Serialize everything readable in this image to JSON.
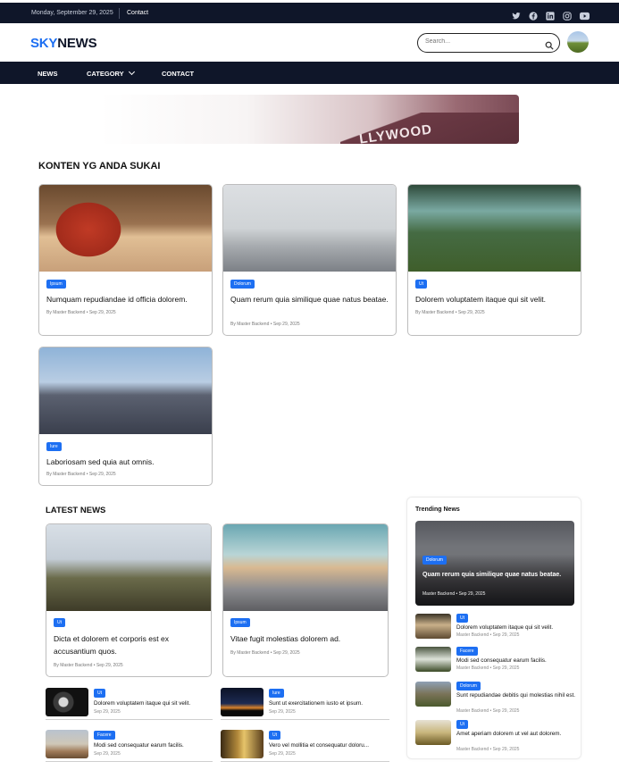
{
  "topbar": {
    "date": "Monday, September 29, 2025",
    "contact": "Contact",
    "socials": [
      "twitter-icon",
      "facebook-icon",
      "linkedin-icon",
      "instagram-icon",
      "youtube-icon"
    ]
  },
  "header": {
    "logo_sky": "SKY",
    "logo_news": "NEWS",
    "search_placeholder": "Search..."
  },
  "nav": {
    "items": [
      "NEWS",
      "CATEGORY",
      "CONTACT"
    ]
  },
  "banner": {
    "sign_text": "LLYWOOD"
  },
  "favorites": {
    "title": "KONTEN YG ANDA SUKAI",
    "cards": [
      {
        "badge": "Ipsum",
        "title": "Numquam repudiandae id officia dolorem.",
        "meta": "By Master Backend • Sep 29, 2025"
      },
      {
        "badge": "Dolorum",
        "title": "Quam rerum quia similique quae natus beatae.",
        "meta": "By Master Backend • Sep 29, 2025"
      },
      {
        "badge": "Ut",
        "title": "Dolorem voluptatem itaque qui sit velit.",
        "meta": "By Master Backend • Sep 29, 2025"
      },
      {
        "badge": "Iure",
        "title": "Laboriosam sed quia aut omnis.",
        "meta": "By Master Backend • Sep 29, 2025"
      }
    ]
  },
  "latest": {
    "title": "LATEST NEWS",
    "cards": [
      {
        "badge": "Ut",
        "title": "Dicta et dolorem et corporis est ex accusantium quos.",
        "meta": "By Master Backend • Sep 29, 2025"
      },
      {
        "badge": "Ipsum",
        "title": "Vitae fugit molestias dolorem ad.",
        "meta": "By Master Backend • Sep 29, 2025"
      }
    ],
    "small": [
      {
        "badge": "Ut",
        "title": "Dolorem voluptatem itaque qui sit velit.",
        "date": "Sep 29, 2025"
      },
      {
        "badge": "Iure",
        "title": "Sunt ut exercitationem iusto et ipsum.",
        "date": "Sep 29, 2025"
      },
      {
        "badge": "Facere",
        "title": "Modi sed consequatur earum facilis.",
        "date": "Sep 29, 2025"
      },
      {
        "badge": "Ut",
        "title": "Vero vel mollitia et consequatur doloru...",
        "date": "Sep 29, 2025"
      }
    ]
  },
  "trending": {
    "title": "Trending News",
    "hero": {
      "badge": "Dolorum",
      "title": "Quam rerum quia similique quae natus beatae.",
      "meta": "Master Backend • Sep 29, 2025"
    },
    "items": [
      {
        "badge": "Ut",
        "title": "Dolorem voluptatem itaque qui sit velit.",
        "meta": "Master Backend • Sep 29, 2025"
      },
      {
        "badge": "Facere",
        "title": "Modi sed consequatur earum facilis.",
        "meta": "Master Backend • Sep 29, 2025"
      },
      {
        "badge": "Dolorum",
        "title": "Sunt repudiandae debitis qui molestias nihil est.",
        "meta": "Master Backend • Sep 29, 2025"
      },
      {
        "badge": "Ut",
        "title": "Amet aperiam dolorem ut vel aut dolorem.",
        "meta": "Master Backend • Sep 29, 2025"
      }
    ]
  },
  "colors": {
    "brand_blue": "#1d6ff2",
    "navy": "#0f1629"
  }
}
